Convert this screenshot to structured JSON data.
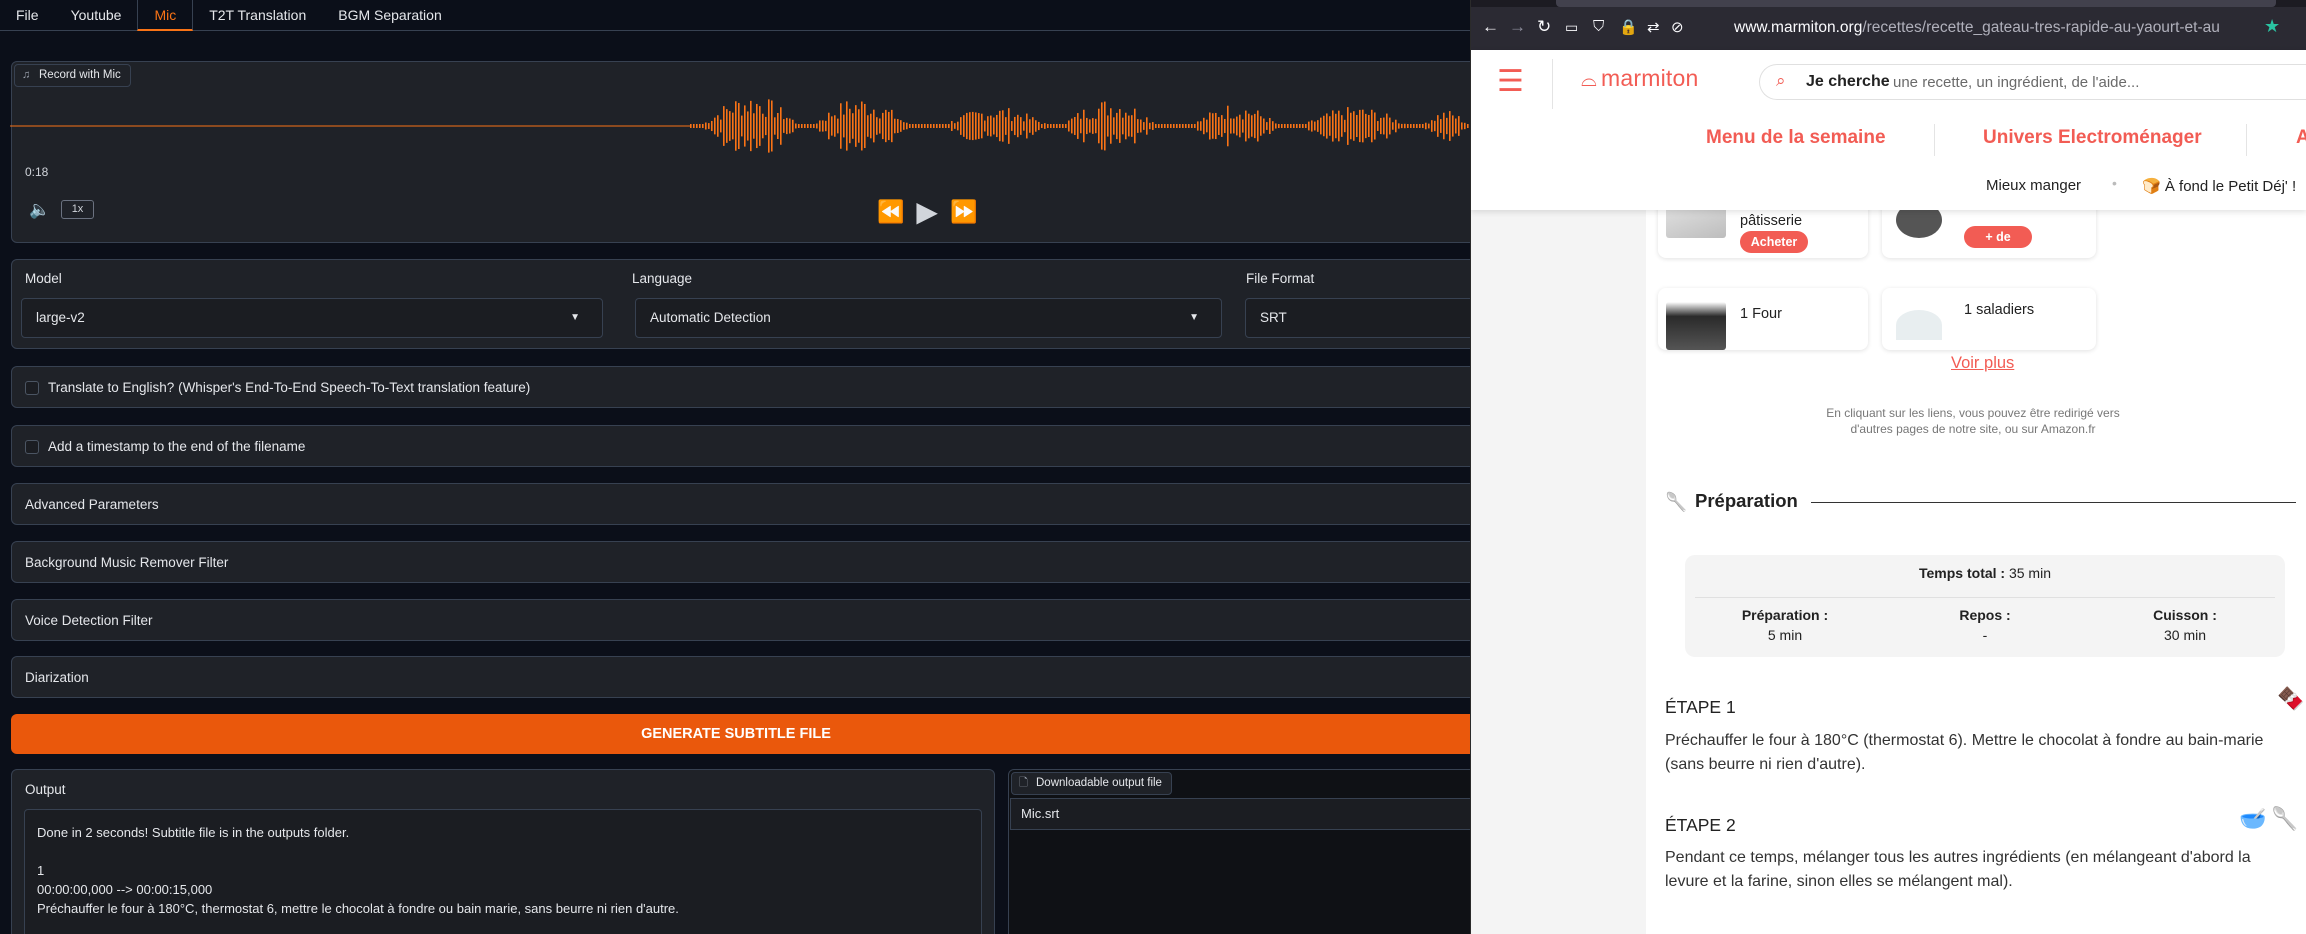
{
  "tabs": [
    "File",
    "Youtube",
    "Mic",
    "T2T Translation",
    "BGM Separation"
  ],
  "audio": {
    "label": "Record with Mic",
    "time": "0:18",
    "speed": "1x",
    "icons": {
      "music": "music-note-icon",
      "volume": "volume-icon",
      "rewind": "rewind-icon",
      "play": "play-icon",
      "forward": "fast-forward-icon"
    }
  },
  "params": {
    "model_label": "Model",
    "model_value": "large-v2",
    "language_label": "Language",
    "language_value": "Automatic Detection",
    "format_label": "File Format",
    "format_value": "SRT"
  },
  "options": {
    "translate": "Translate to English? (Whisper's End-To-End Speech-To-Text translation feature)",
    "timestamp": "Add a timestamp to the end of the filename"
  },
  "accordions": {
    "advanced": "Advanced Parameters",
    "bgm": "Background Music Remover Filter",
    "vad": "Voice Detection Filter",
    "diarization": "Diarization"
  },
  "generate_label": "GENERATE SUBTITLE FILE",
  "output": {
    "label": "Output",
    "line1": "Done in 2 seconds! Subtitle file is in the outputs folder.",
    "line2": "1",
    "line3": "00:00:00,000 --> 00:00:15,000",
    "line4": "Préchauffer le four à 180°C, thermostat 6, mettre le chocolat à fondre ou bain marie, sans beurre ni rien d'autre."
  },
  "download": {
    "label": "Downloadable output file",
    "file": "Mic.srt"
  },
  "browser": {
    "url_domain": "www.marmiton.org",
    "url_path": "/recettes/recette_gateau-tres-rapide-au-yaourt-et-au"
  },
  "site": {
    "logo": "marmiton",
    "search_strong": "Je cherche",
    "search_placeholder": "une recette, un ingrédient, de l'aide...",
    "menu_1": "Menu de la semaine",
    "menu_2": "Univers Electroménager",
    "menu_3": "A",
    "sub_1": "Mieux manger",
    "sub_2": "À fond le Petit Déj' !"
  },
  "products": {
    "card1_text": "pâtisserie",
    "card1_btn": "Acheter",
    "card2_btn": "+ de détails",
    "card3_text": "1 Four",
    "card4_text": "1 saladiers",
    "voir_plus": "Voir plus",
    "disclaimer": "En cliquant sur les liens, vous pouvez être redirigé vers d'autres pages de notre site, ou sur Amazon.fr"
  },
  "preparation": {
    "title": "Préparation",
    "total_label": "Temps total :",
    "total_value": "35 min",
    "prep_label": "Préparation :",
    "prep_value": "5 min",
    "repos_label": "Repos :",
    "repos_value": "-",
    "cuisson_label": "Cuisson :",
    "cuisson_value": "30 min"
  },
  "steps": [
    {
      "title": "ÉTAPE 1",
      "text": "Préchauffer le four à 180°C (thermostat 6). Mettre le chocolat à fondre au bain-marie (sans beurre ni rien d'autre)."
    },
    {
      "title": "ÉTAPE 2",
      "text": "Pendant ce temps, mélanger tous les autres ingrédients (en mélangeant d'abord la levure et la farine, sinon elles se mélangent mal)."
    }
  ],
  "colors": {
    "accent": "#ea580c",
    "waveform": "#f97316",
    "marmiton": "#f25c54"
  }
}
